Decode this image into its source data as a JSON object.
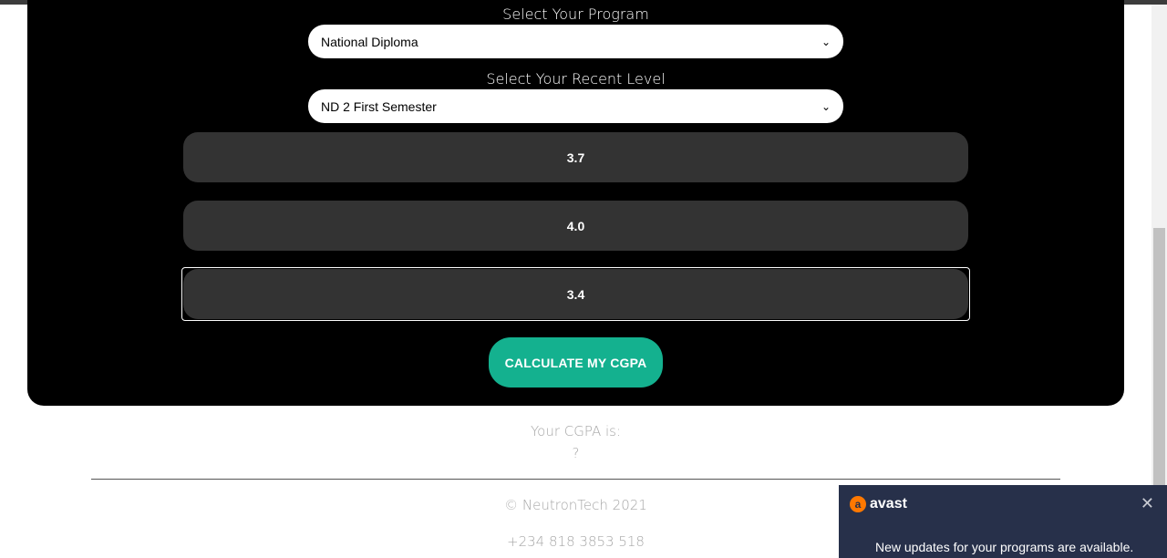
{
  "program": {
    "label": "Select Your Program",
    "selected": "National Diploma"
  },
  "level": {
    "label": "Select Your Recent Level",
    "selected": "ND 2 First Semester"
  },
  "gpa_inputs": [
    "3.7",
    "4.0",
    "3.4"
  ],
  "calculate_button": "CALCULATE MY CGPA",
  "result": {
    "label": "Your CGPA is:",
    "value": "?"
  },
  "footer": {
    "copyright": "© NeutronTech 2021",
    "phone": "+234 818 3853 518"
  },
  "avast_popup": {
    "brand": "avast",
    "message": "New updates for your programs are available.",
    "close_icon": "close-icon"
  },
  "colors": {
    "accent": "#14b18f",
    "panel": "#000000",
    "input_bg": "#333333",
    "popup_bg": "#27304a",
    "avast_orange": "#ff7800"
  }
}
